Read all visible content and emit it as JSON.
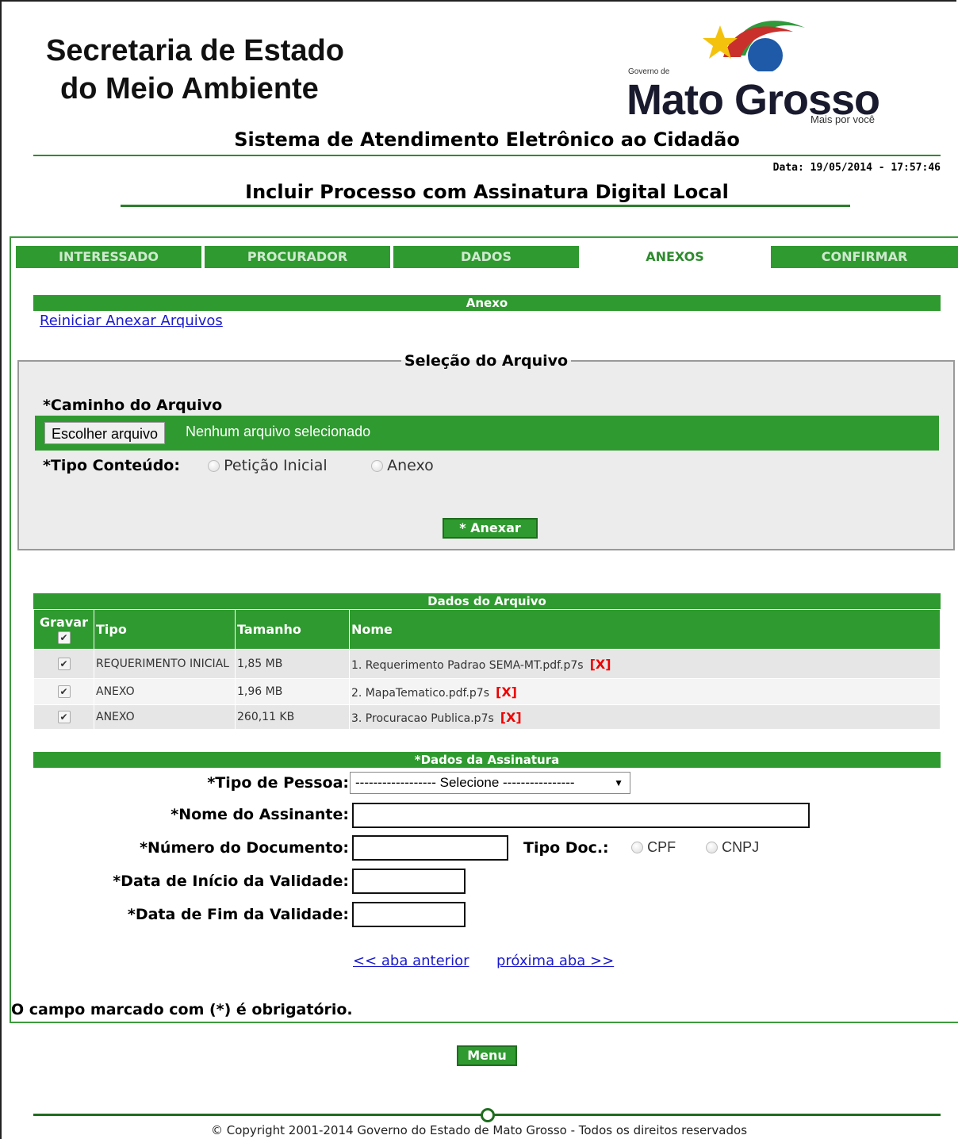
{
  "header": {
    "org_line1": "Secretaria de Estado",
    "org_line2": "do Meio Ambiente",
    "logo_governo": "Governo de",
    "logo_name": "Mato Grosso",
    "logo_slogan": "Mais por você",
    "system_title": "Sistema de Atendimento Eletrônico ao Cidadão",
    "date": "Data: 19/05/2014 - 17:57:46",
    "page_title": "Incluir Processo com Assinatura Digital Local"
  },
  "tabs": [
    {
      "label": "INTERESSADO",
      "active": false
    },
    {
      "label": "PROCURADOR",
      "active": false
    },
    {
      "label": "DADOS",
      "active": false
    },
    {
      "label": "ANEXOS",
      "active": true
    },
    {
      "label": "CONFIRMAR",
      "active": false
    }
  ],
  "anexo": {
    "bar_title": "Anexo",
    "restart_link": "Reiniciar Anexar Arquivos",
    "legend": "Seleção do Arquivo",
    "path_label": "*Caminho do Arquivo",
    "choose_button": "Escolher arquivo",
    "no_file": "Nenhum arquivo selecionado",
    "tipo_label": "*Tipo Conteúdo:",
    "tipo_options": [
      "Petição Inicial",
      "Anexo"
    ],
    "anexar_button": "* Anexar"
  },
  "files": {
    "bar_title": "Dados do Arquivo",
    "headers": {
      "gravar": "Gravar",
      "tipo": "Tipo",
      "tamanho": "Tamanho",
      "nome": "Nome"
    },
    "rows": [
      {
        "checked": true,
        "tipo": "REQUERIMENTO INICIAL",
        "tamanho": "1,85 MB",
        "nome": "1. Requerimento Padrao SEMA-MT.pdf.p7s",
        "remove": "[X]"
      },
      {
        "checked": true,
        "tipo": "ANEXO",
        "tamanho": "1,96 MB",
        "nome": "2. MapaTematico.pdf.p7s",
        "remove": "[X]"
      },
      {
        "checked": true,
        "tipo": "ANEXO",
        "tamanho": "260,11 KB",
        "nome": "3. Procuracao Publica.p7s",
        "remove": "[X]"
      }
    ]
  },
  "assinatura": {
    "bar_title": "*Dados da Assinatura",
    "tipo_pessoa_label": "*Tipo de Pessoa:",
    "tipo_pessoa_value": "------------------ Selecione ----------------",
    "nome_label": "*Nome do Assinante:",
    "numero_label": "*Número do Documento:",
    "tipo_doc_label": "Tipo Doc.:",
    "tipo_doc_options": [
      "CPF",
      "CNPJ"
    ],
    "inicio_label": "*Data de Início da Validade:",
    "fim_label": "*Data de Fim da Validade:"
  },
  "nav": {
    "prev": "<< aba anterior",
    "next": "próxima aba >>"
  },
  "required_note": "O campo marcado com (*) é obrigatório.",
  "menu_button": "Menu",
  "copyright": "© Copyright 2001-2014 Governo do Estado de Mato Grosso - Todos os direitos reservados",
  "colors": {
    "brand_green": "#2f9a2f",
    "link_blue": "#1a1acc",
    "remove_red": "#ee0000"
  }
}
